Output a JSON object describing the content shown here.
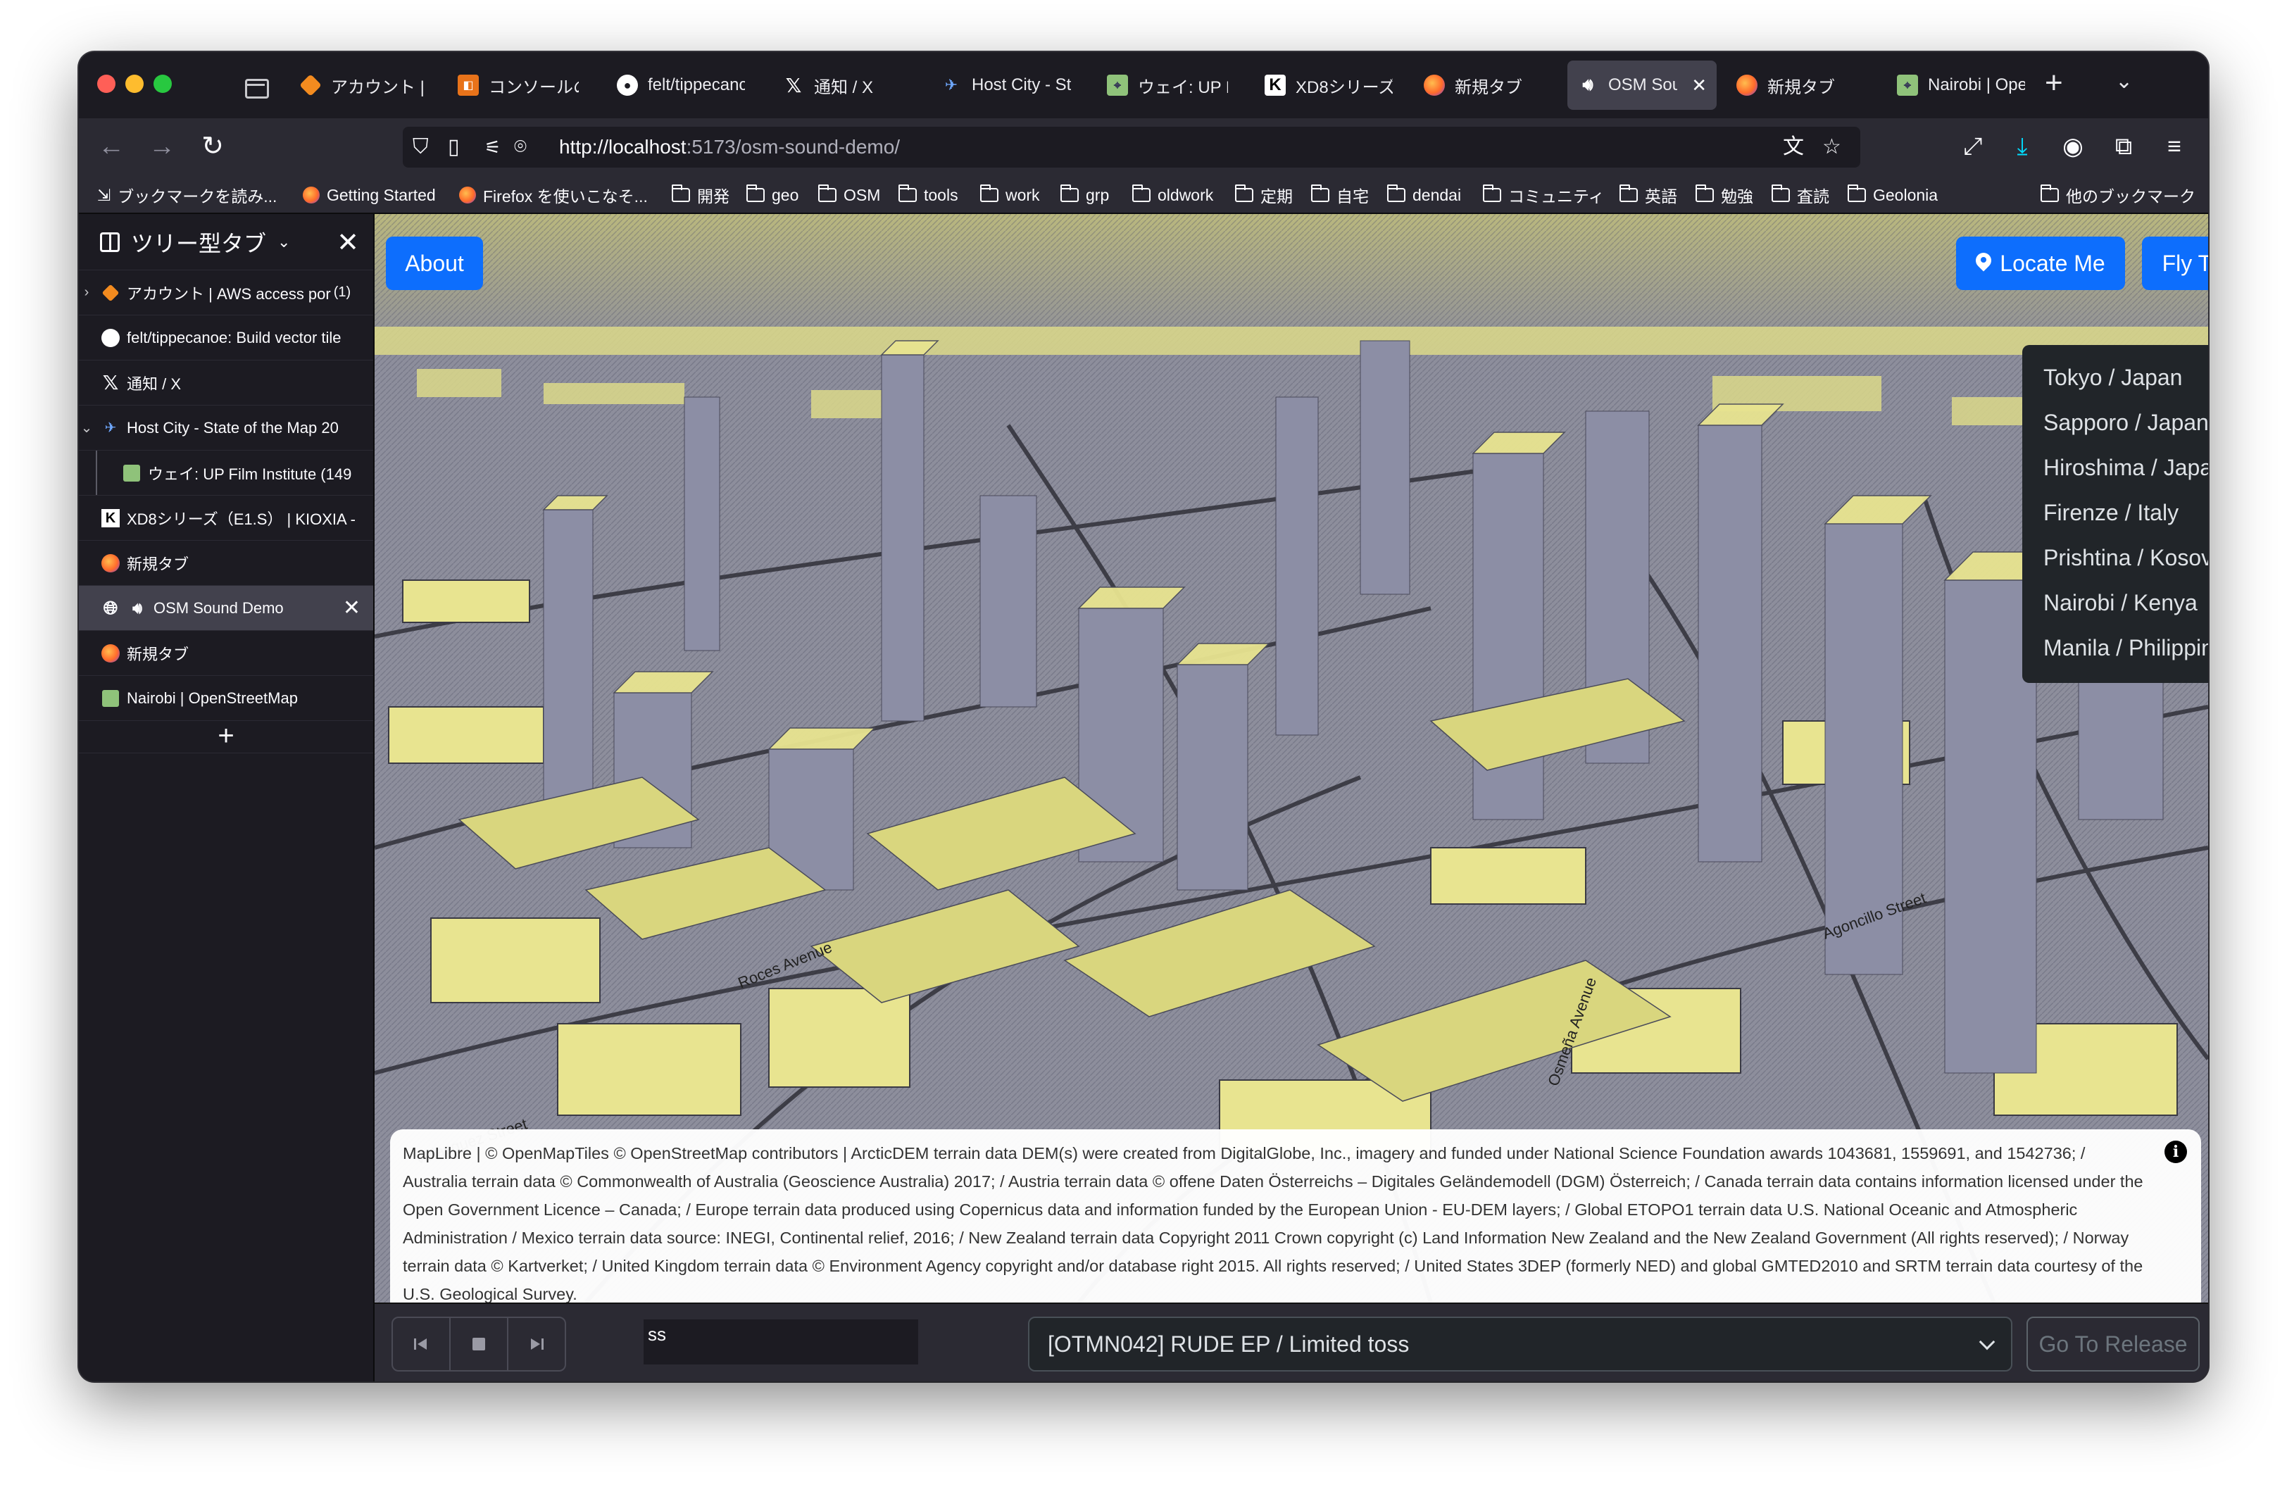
{
  "browser": {
    "tabs": [
      {
        "label": "アカウント | A",
        "icon": "aws-icon"
      },
      {
        "label": "コンソールの",
        "icon": "console-icon"
      },
      {
        "label": "felt/tippecanc",
        "icon": "github-icon"
      },
      {
        "label": "通知 / X",
        "icon": "x-icon"
      },
      {
        "label": "Host City - St",
        "icon": "host-city-icon"
      },
      {
        "label": "ウェイ: UP Fil",
        "icon": "osm-icon"
      },
      {
        "label": "XD8シリーズ",
        "icon": "kioxia-icon"
      },
      {
        "label": "新規タブ",
        "icon": "firefox-icon"
      },
      {
        "label": "OSM Sour",
        "icon": "speaker-icon",
        "active": true
      },
      {
        "label": "新規タブ",
        "icon": "firefox-icon"
      },
      {
        "label": "Nairobi | Ope",
        "icon": "osm-icon"
      }
    ],
    "url": {
      "host": "http://localhost",
      "path": ":5173/osm-sound-demo/"
    },
    "bookmarks": [
      {
        "label": "ブックマークを読み..."
      },
      {
        "label": "Getting Started"
      },
      {
        "label": "Firefox を使いこなそ..."
      },
      {
        "label": "開発"
      },
      {
        "label": "geo"
      },
      {
        "label": "OSM"
      },
      {
        "label": "tools"
      },
      {
        "label": "work"
      },
      {
        "label": "grp"
      },
      {
        "label": "oldwork"
      },
      {
        "label": "定期"
      },
      {
        "label": "自宅"
      },
      {
        "label": "dendai"
      },
      {
        "label": "コミュニティ"
      },
      {
        "label": "英語"
      },
      {
        "label": "勉強"
      },
      {
        "label": "査読"
      },
      {
        "label": "Geolonia"
      },
      {
        "label": "他のブックマーク"
      }
    ]
  },
  "sidebar": {
    "title": "ツリー型タブ",
    "items": [
      {
        "label": "アカウント | AWS access por",
        "count": "(1)"
      },
      {
        "label": "felt/tippecanoe: Build vector tile"
      },
      {
        "label": "通知 / X"
      },
      {
        "label": "Host City - State of the Map 20"
      },
      {
        "label": "ウェイ: UP Film Institute (149"
      },
      {
        "label": "XD8シリーズ（E1.S） | KIOXIA -"
      },
      {
        "label": "新規タブ"
      },
      {
        "label": "OSM Sound Demo"
      },
      {
        "label": "新規タブ"
      },
      {
        "label": "Nairobi | OpenStreetMap"
      }
    ],
    "new_tab": "+"
  },
  "map": {
    "about_label": "About",
    "locate_label": "Locate Me",
    "flyto_label": "Fly To",
    "flyto_options": [
      "Tokyo / Japan",
      "Sapporo / Japan",
      "Hiroshima / Japan",
      "Firenze / Italy",
      "Prishtina / Kosovo",
      "Nairobi / Kenya",
      "Manila / Philippines"
    ],
    "street_labels": [
      "Velasquez Street",
      "Osmeña Avenue",
      "Agoncillo Street",
      "Roces Avenue"
    ],
    "attribution": "MapLibre | © OpenMapTiles © OpenStreetMap contributors | ArcticDEM terrain data DEM(s) were created from DigitalGlobe, Inc., imagery and funded under National Science Foundation awards 1043681, 1559691, and 1542736; / Australia terrain data © Commonwealth of Australia (Geoscience Australia) 2017; / Austria terrain data © offene Daten Österreichs – Digitales Geländemodell (DGM) Österreich; / Canada terrain data contains information licensed under the Open Government Licence – Canada; / Europe terrain data produced using Copernicus data and information funded by the European Union - EU-DEM layers; / Global ETOPO1 terrain data U.S. National Oceanic and Atmospheric Administration / Mexico terrain data source: INEGI, Continental relief, 2016; / New Zealand terrain data Copyright 2011 Crown copyright (c) Land Information New Zealand and the New Zealand Government (All rights reserved); / Norway terrain data © Kartverket; / United Kingdom terrain data © Environment Agency copyright and/or database right 2015. All rights reserved; / United States 3DEP (formerly NED) and global GMTED2010 and SRTM terrain data courtesy of the U.S. Geological Survey.",
    "colors": {
      "building": "#e8e490",
      "ground": "#8d8e9c",
      "accent": "#0d6efd"
    }
  },
  "player": {
    "ticker_text": "ss",
    "release_selected": "[OTMN042] RUDE EP / Limited toss",
    "goto_label": "Go To Release"
  }
}
